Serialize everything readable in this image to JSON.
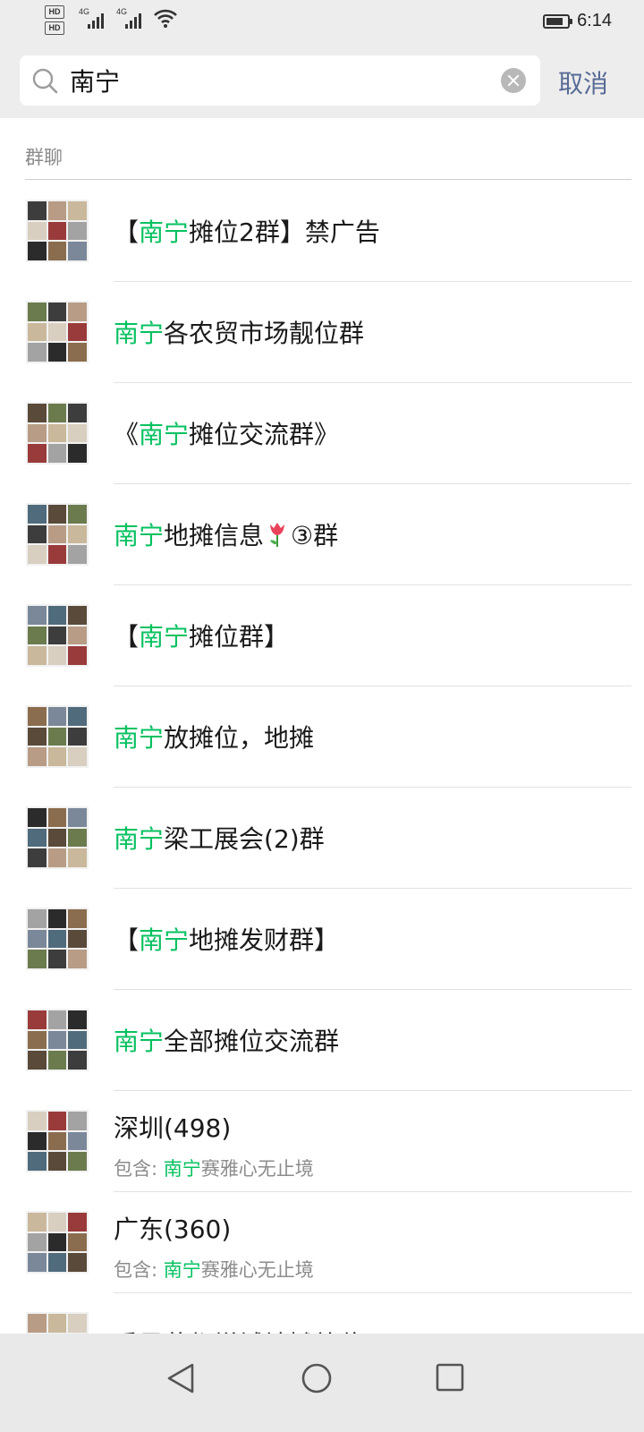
{
  "status_bar": {
    "hd_badges": [
      "HD",
      "HD"
    ],
    "signal_labels": [
      "4G",
      "4G"
    ],
    "time": "6:14"
  },
  "search": {
    "query": "南宁",
    "cancel_label": "取消"
  },
  "section": {
    "label": "群聊"
  },
  "results": [
    {
      "pre": "【",
      "hl": "南宁",
      "post": "摊位2群】禁广告"
    },
    {
      "pre": "",
      "hl": "南宁",
      "post": "各农贸市场靓位群"
    },
    {
      "pre": "《",
      "hl": "南宁",
      "post": "摊位交流群》"
    },
    {
      "pre": "",
      "hl": "南宁",
      "post": "地摊信息",
      "emoji": "tulip",
      "post2": "③群"
    },
    {
      "pre": "【",
      "hl": "南宁",
      "post": "摊位群】"
    },
    {
      "pre": "",
      "hl": "南宁",
      "post": "放摊位，地摊"
    },
    {
      "pre": "",
      "hl": "南宁",
      "post": "梁工展会(2)群"
    },
    {
      "pre": "【",
      "hl": "南宁",
      "post": "地摊发财群】"
    },
    {
      "pre": "",
      "hl": "南宁",
      "post": "全部摊位交流群"
    },
    {
      "title": "深圳(498)",
      "sub_pre": "包含: ",
      "sub_hl": "南宁",
      "sub_post": "赛雅心无止境"
    },
    {
      "title": "广东(360)",
      "sub_pre": "包含: ",
      "sub_hl": "南宁",
      "sub_post": "赛雅心无止境"
    },
    {
      "title": "番禺花都增城地摊放位..."
    }
  ],
  "colors": {
    "highlight": "#07c160",
    "cancel": "#576b95",
    "header_bg": "#ededed"
  },
  "nav": {
    "icons": [
      "back-triangle-icon",
      "home-circle-icon",
      "recents-square-icon"
    ]
  }
}
